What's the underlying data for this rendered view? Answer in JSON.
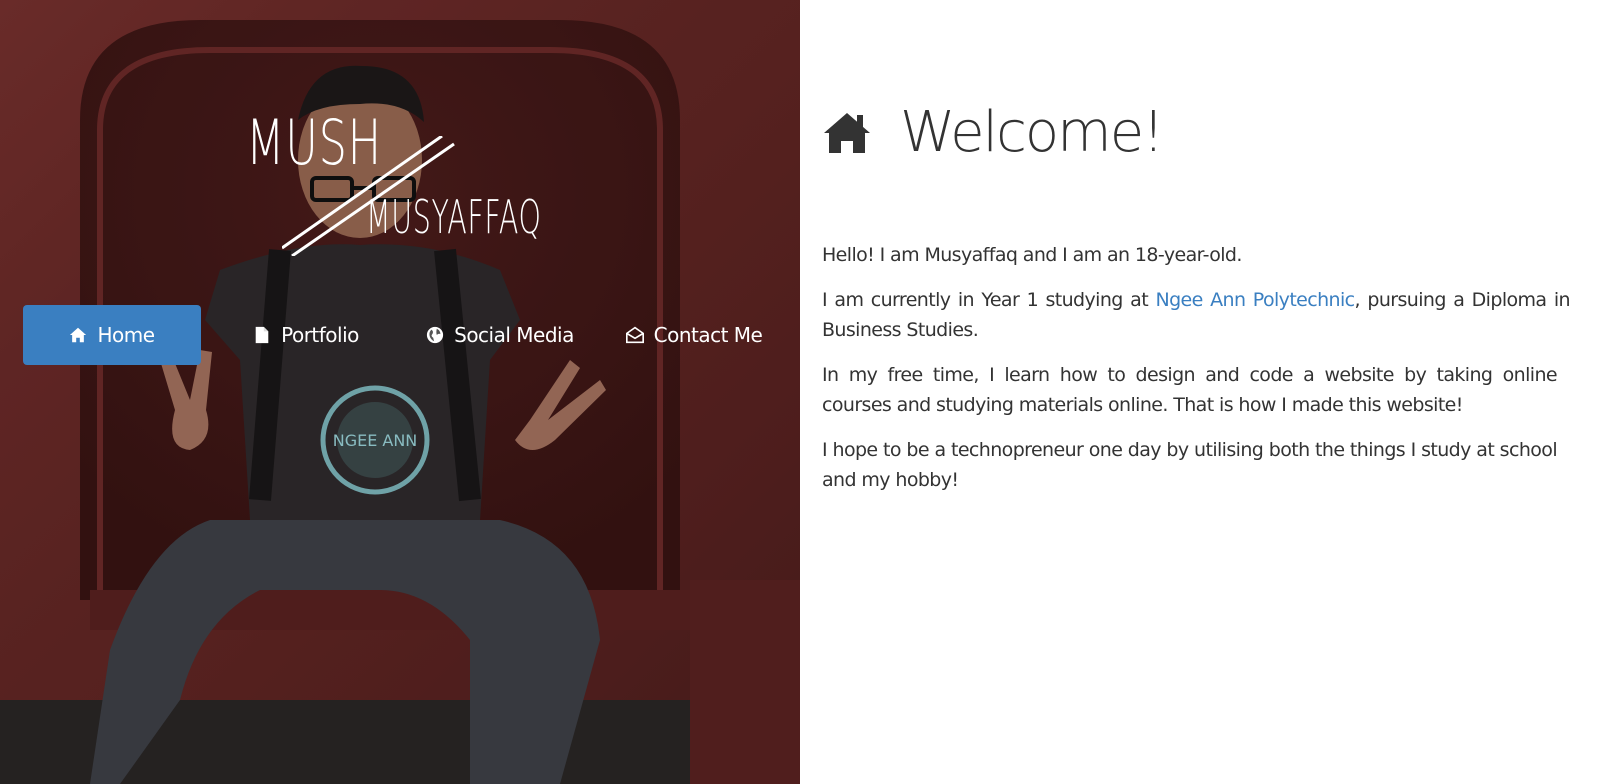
{
  "brand": {
    "logo_line1": "MUSH",
    "logo_line2": "MUSYAFFAQ"
  },
  "nav": {
    "items": [
      {
        "label": "Home",
        "icon": "home-icon",
        "active": true
      },
      {
        "label": "Portfolio",
        "icon": "file-icon",
        "active": false
      },
      {
        "label": "Social Media",
        "icon": "globe-icon",
        "active": false
      },
      {
        "label": "Contact Me",
        "icon": "envelope-open-icon",
        "active": false
      }
    ]
  },
  "main": {
    "title": "Welcome!",
    "title_icon": "home-icon",
    "paragraphs": {
      "p1": "Hello! I am Musyaffaq and I am an 18-year-old.",
      "p2_before": "I am currently in Year 1 studying at ",
      "p2_link": "Ngee Ann Polytechnic",
      "p2_after": ", pursuing a Diploma in Business Studies.",
      "p3": "In my free time, I learn how to design and code a website by taking online courses and studying materials online. That is how I made this website!",
      "p4": "I hope to be a technopreneur one day by utilising both the things I study at school and my hobby!"
    }
  },
  "colors": {
    "accent": "#3a7fc1",
    "text": "#333333",
    "hero_bg": "#5b2424"
  }
}
